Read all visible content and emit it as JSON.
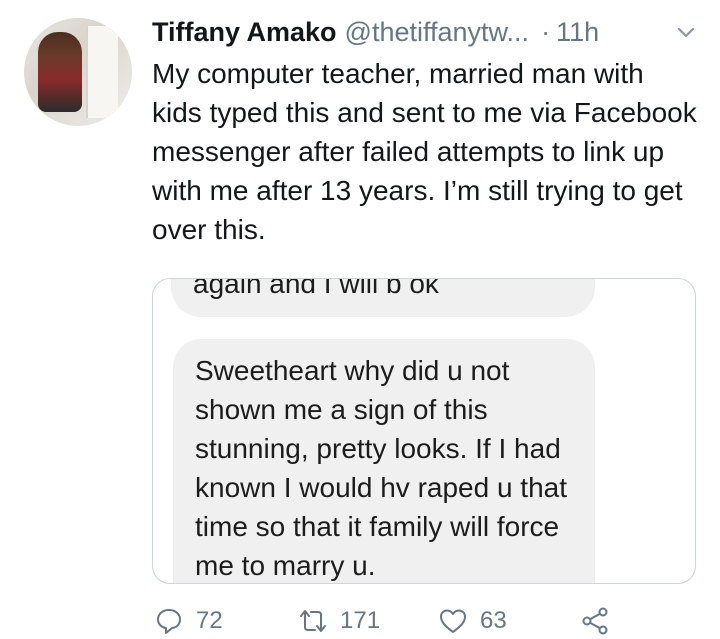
{
  "tweet": {
    "author_name": "Tiffany Amako",
    "handle": "@thetiffanytw...",
    "separator": "·",
    "time": "11h",
    "text": "My computer teacher, married man with kids typed this and sent to me via Facebook messenger after failed attempts to link up with me after 13 years. I’m still trying to get over this."
  },
  "media": {
    "partial_message": "again and I will b ok",
    "message": "Sweetheart why did u not shown me a sign of this stunning, pretty looks. If I had known I would hv raped u that time so that it family will force me to marry u."
  },
  "actions": {
    "replies": "72",
    "retweets": "171",
    "likes": "63"
  },
  "icons": [
    "avatar",
    "chevron-down-icon",
    "reply-icon",
    "retweet-icon",
    "like-icon",
    "share-icon"
  ],
  "colors": {
    "text": "#14171a",
    "secondary": "#657786",
    "bubble": "#f0f0f0",
    "border": "#ccd6dd"
  }
}
